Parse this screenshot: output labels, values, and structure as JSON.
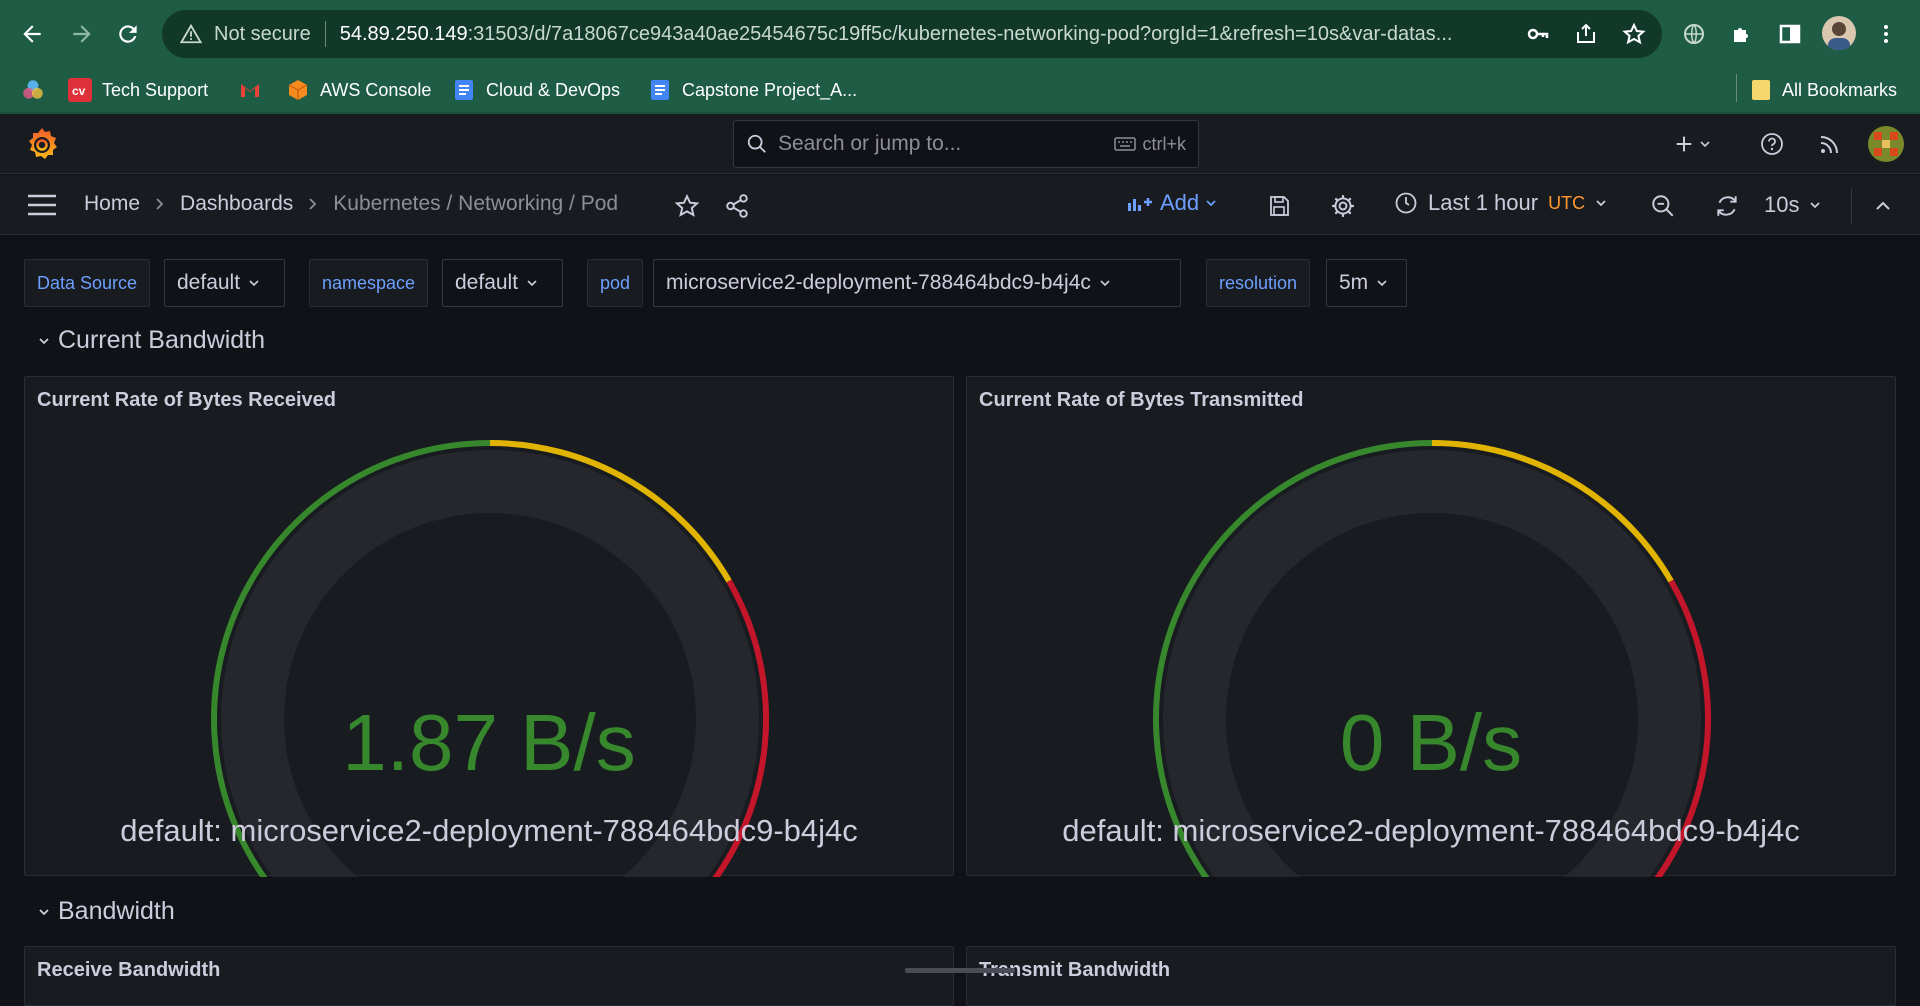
{
  "browser": {
    "security_label": "Not secure",
    "url_host": "54.89.250.149",
    "url_rest": ":31503/d/7a18067ce943a40ae25454675c19ff5c/kubernetes-networking-pod?orgId=1&refresh=10s&var-datas...",
    "bookmarks": [
      "Tech Support",
      "AWS Console",
      "Cloud & DevOps",
      "Capstone Project_A..."
    ],
    "all_bookmarks": "All Bookmarks"
  },
  "grafana": {
    "search_placeholder": "Search or jump to...",
    "search_shortcut": "ctrl+k",
    "breadcrumb": [
      "Home",
      "Dashboards",
      "Kubernetes / Networking / Pod"
    ],
    "add_label": "Add",
    "time_range": "Last 1 hour",
    "timezone": "UTC",
    "refresh_interval": "10s"
  },
  "variables": [
    {
      "label": "Data Source",
      "value": "default"
    },
    {
      "label": "namespace",
      "value": "default"
    },
    {
      "label": "pod",
      "value": "microservice2-deployment-788464bdc9-b4j4c"
    },
    {
      "label": "resolution",
      "value": "5m"
    }
  ],
  "rows": {
    "current_bandwidth": "Current Bandwidth",
    "bandwidth": "Bandwidth"
  },
  "panels": {
    "received": {
      "title": "Current Rate of Bytes Received",
      "value": "1.87 B/s",
      "label": "default: microservice2-deployment-788464bdc9-b4j4c",
      "fill_fraction": 0.004
    },
    "transmitted": {
      "title": "Current Rate of Bytes Transmitted",
      "value": "0 B/s",
      "label": "default: microservice2-deployment-788464bdc9-b4j4c",
      "fill_fraction": 0
    },
    "receive_bw_title": "Receive Bandwidth",
    "transmit_bw_title": "Transmit Bandwidth"
  },
  "colors": {
    "chrome_green": "#1f5c45",
    "threshold_green": "#37872d",
    "threshold_yellow": "#e0b400",
    "threshold_red": "#c4162a",
    "accent_blue": "#6e9fff",
    "utc_orange": "#ff9830"
  }
}
